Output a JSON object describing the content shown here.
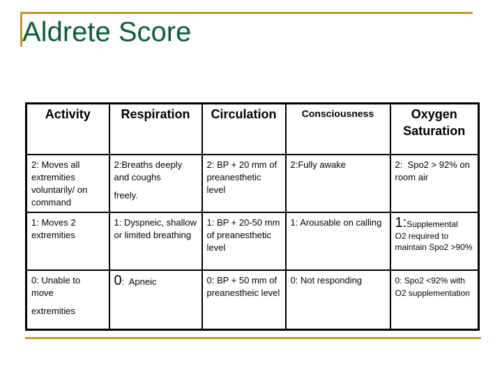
{
  "slide": {
    "title": "Aldrete Score",
    "colors": {
      "title": "#0b5e36",
      "accent_gold": "#c09a2a"
    }
  },
  "table": {
    "headers": {
      "activity": "Activity",
      "respiration": "Respiration",
      "circulation": "Circulation",
      "consciousness": "Consciousness",
      "oxygen_line1": "Oxygen",
      "oxygen_line2": "Saturation"
    },
    "rows": [
      {
        "activity": [
          "2:  Moves all extremities voluntarily/ on command"
        ],
        "respiration": [
          "2:Breaths deeply and coughs",
          "freely."
        ],
        "circulation": [
          "2:  BP + 20 mm of preanesthetic level"
        ],
        "consciousness": [
          "2:Fully awake"
        ],
        "oxygen": {
          "score": "2:",
          "text": "  Spo2 > 92% on room air"
        }
      },
      {
        "activity": [
          "1:  Moves 2 extremities"
        ],
        "respiration": [
          "1:  Dyspneic, shallow or limited breathing"
        ],
        "circulation": [
          "1:  BP + 20-50 mm of preanesthetic level"
        ],
        "consciousness": [
          "1:  Arousable on calling"
        ],
        "oxygen": {
          "score": "1:",
          "text_small": "Supplemental",
          "text": "O2 required to maintain Spo2 >90%"
        }
      },
      {
        "activity": [
          "0: Unable to move",
          "extremities"
        ],
        "respiration": {
          "score": "0",
          "text": ":  Apneic"
        },
        "circulation": [
          "0:  BP + 50 mm of preanestheic level"
        ],
        "consciousness": [
          "0:  Not responding"
        ],
        "oxygen": {
          "score": "0:",
          "text": " Spo2 <92% with O2 supplementation"
        }
      }
    ]
  }
}
